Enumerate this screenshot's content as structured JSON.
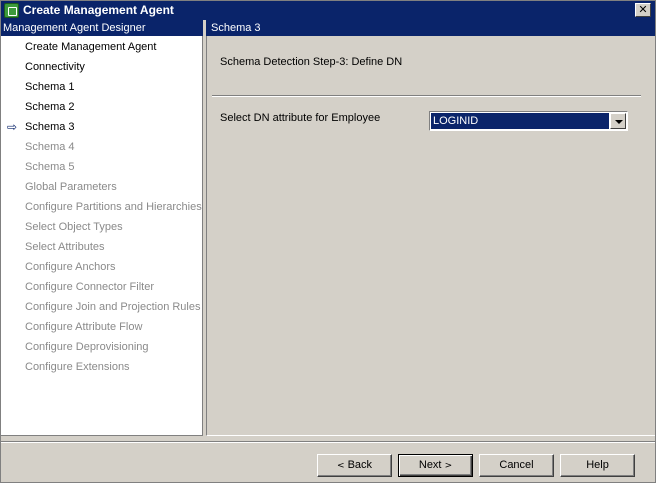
{
  "window": {
    "title": "Create Management Agent",
    "close_glyph": "✕"
  },
  "left_header": "Management Agent Designer",
  "right_header": "Schema 3",
  "nav": {
    "current_marker": "⇨",
    "items": [
      {
        "label": "Create Management Agent",
        "enabled": true
      },
      {
        "label": "Connectivity",
        "enabled": true
      },
      {
        "label": "Schema 1",
        "enabled": true
      },
      {
        "label": "Schema 2",
        "enabled": true
      },
      {
        "label": "Schema 3",
        "enabled": true,
        "current": true
      },
      {
        "label": "Schema 4",
        "enabled": false
      },
      {
        "label": "Schema 5",
        "enabled": false
      },
      {
        "label": "Global Parameters",
        "enabled": false
      },
      {
        "label": "Configure Partitions and Hierarchies",
        "enabled": false
      },
      {
        "label": "Select Object Types",
        "enabled": false
      },
      {
        "label": "Select Attributes",
        "enabled": false
      },
      {
        "label": "Configure Anchors",
        "enabled": false
      },
      {
        "label": "Configure Connector Filter",
        "enabled": false
      },
      {
        "label": "Configure Join and Projection Rules",
        "enabled": false
      },
      {
        "label": "Configure Attribute Flow",
        "enabled": false
      },
      {
        "label": "Configure Deprovisioning",
        "enabled": false
      },
      {
        "label": "Configure Extensions",
        "enabled": false
      }
    ]
  },
  "main": {
    "step_title": "Schema Detection Step-3: Define DN",
    "dn_label": "Select DN attribute for Employee",
    "dn_value": "LOGINID"
  },
  "buttons": {
    "back": "Back",
    "back_glyph": "<",
    "next": "Next",
    "next_glyph": ">",
    "cancel": "Cancel",
    "help": "Help"
  },
  "colors": {
    "titlebar": "#0a246a",
    "face": "#d4d0c8",
    "disabled_text": "#8a8a8a"
  }
}
